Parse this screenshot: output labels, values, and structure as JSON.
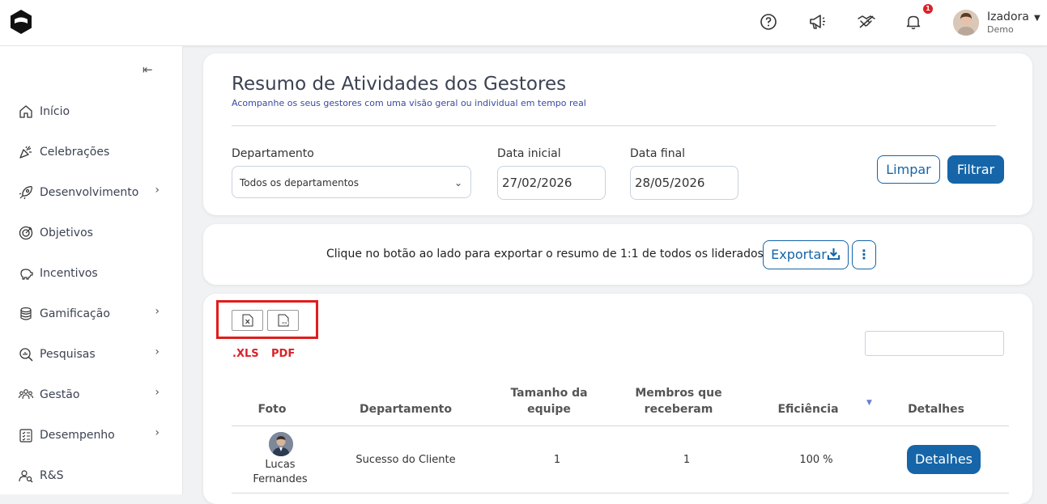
{
  "header": {
    "user_name": "Izadora",
    "user_role": "Demo",
    "notifications_count": "1"
  },
  "sidebar": {
    "collapse_icon": "⇤",
    "items": [
      {
        "label": "Início",
        "icon": "home-icon"
      },
      {
        "label": "Celebrações",
        "icon": "party-icon"
      },
      {
        "label": "Desenvolvimento",
        "icon": "rocket-icon",
        "has_children": true
      },
      {
        "label": "Objetivos",
        "icon": "target-icon"
      },
      {
        "label": "Incentivos",
        "icon": "piggy-bank-icon"
      },
      {
        "label": "Gamificação",
        "icon": "coins-icon",
        "has_children": true
      },
      {
        "label": "Pesquisas",
        "icon": "search-chart-icon",
        "has_children": true
      },
      {
        "label": "Gestão",
        "icon": "team-icon",
        "has_children": true
      },
      {
        "label": "Desempenho",
        "icon": "checklist-icon",
        "has_children": true
      },
      {
        "label": "R&S",
        "icon": "user-search-icon"
      }
    ]
  },
  "page": {
    "title": "Resumo de Atividades dos Gestores",
    "subtitle": "Acompanhe os seus gestores com uma visão geral ou individual em tempo real"
  },
  "filters": {
    "department_label": "Departamento",
    "department_value": "Todos os departamentos",
    "start_label": "Data inicial",
    "start_value": "27/02/2026",
    "end_label": "Data final",
    "end_value": "28/05/2026",
    "clear_label": "Limpar",
    "filter_label": "Filtrar"
  },
  "export": {
    "text": "Clique no botão ao lado para exportar o resumo de 1:1 de todos os liderados",
    "button_label": "Exportar"
  },
  "table_tools": {
    "xls_label": ".XLS",
    "pdf_label": "PDF"
  },
  "table": {
    "headers": {
      "photo": "Foto",
      "department": "Departamento",
      "team_size_1": "Tamanho da",
      "team_size_2": "equipe",
      "members_1": "Membros que",
      "members_2": "receberam",
      "efficiency": "Eficiência",
      "details": "Detalhes"
    },
    "rows": [
      {
        "name_first": "Lucas",
        "name_last": "Fernandes",
        "department": "Sucesso do Cliente",
        "team_size": "1",
        "members": "1",
        "efficiency": "100 %",
        "details_label": "Detalhes"
      }
    ]
  },
  "colors": {
    "primary": "#1565a8",
    "highlight_red": "#e11c1c",
    "badge_red": "#d9232a"
  }
}
